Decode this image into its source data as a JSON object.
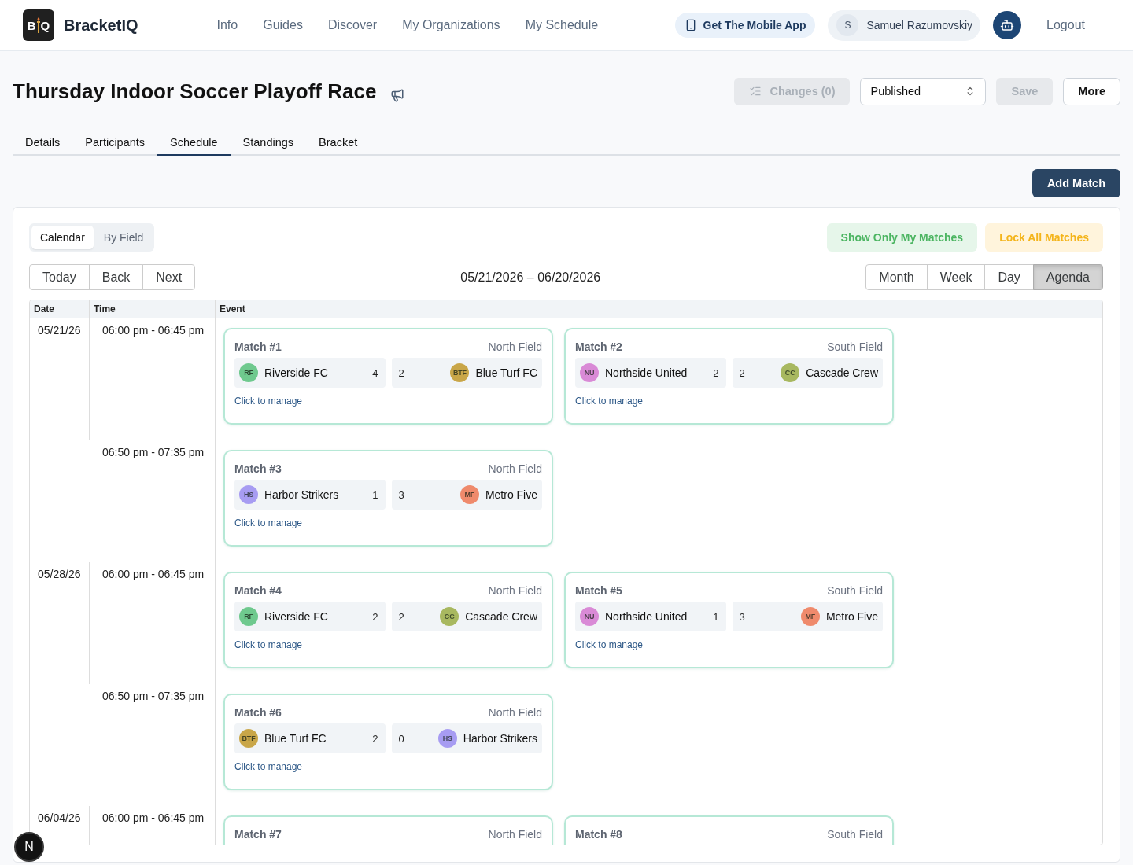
{
  "header": {
    "logo": {
      "letters": [
        "B",
        "Q"
      ]
    },
    "brand": "BracketIQ",
    "nav": [
      "Info",
      "Guides",
      "Discover",
      "My Organizations",
      "My Schedule"
    ],
    "mobile_app": "Get The Mobile App",
    "user": {
      "initial": "S",
      "name": "Samuel Razumovskiy"
    },
    "logout": "Logout"
  },
  "page": {
    "title": "Thursday Indoor Soccer Playoff Race",
    "changes": {
      "label": "Changes (0)",
      "disabled": true
    },
    "status": "Published",
    "save": {
      "label": "Save",
      "disabled": true
    },
    "more": "More"
  },
  "tabs": [
    {
      "label": "Details",
      "selected": false
    },
    {
      "label": "Participants",
      "selected": false
    },
    {
      "label": "Schedule",
      "selected": true
    },
    {
      "label": "Standings",
      "selected": false
    },
    {
      "label": "Bracket",
      "selected": false
    }
  ],
  "add_match": "Add Match",
  "schedule": {
    "view_switch": [
      {
        "label": "Calendar",
        "selected": true
      },
      {
        "label": "By Field",
        "selected": false
      }
    ],
    "show_only_mine": "Show Only My Matches",
    "lock_all": "Lock All Matches",
    "nav_buttons": [
      "Today",
      "Back",
      "Next"
    ],
    "range": "05/21/2026 – 06/20/2026",
    "views": [
      {
        "label": "Month",
        "selected": false
      },
      {
        "label": "Week",
        "selected": false
      },
      {
        "label": "Day",
        "selected": false
      },
      {
        "label": "Agenda",
        "selected": true
      }
    ],
    "agenda": {
      "columns": [
        "Date",
        "Time",
        "Event"
      ],
      "days": [
        {
          "date": "05/21/26",
          "slots": [
            {
              "time": "06:00 pm - 06:45 pm",
              "matches": [
                {
                  "title": "Match #1",
                  "field": "North Field",
                  "home": {
                    "initials": "RF",
                    "name": "Riverside FC",
                    "score": "4",
                    "color": "#6fc98e"
                  },
                  "away": {
                    "initials": "BTF",
                    "name": "Blue Turf FC",
                    "score": "2",
                    "color": "#c9a648"
                  },
                  "action": "Click to manage"
                },
                {
                  "title": "Match #2",
                  "field": "South Field",
                  "home": {
                    "initials": "NU",
                    "name": "Northside United",
                    "score": "2",
                    "color": "#d98ad6"
                  },
                  "away": {
                    "initials": "CC",
                    "name": "Cascade Crew",
                    "score": "2",
                    "color": "#a8b860"
                  },
                  "action": "Click to manage"
                }
              ]
            },
            {
              "time": "06:50 pm - 07:35 pm",
              "matches": [
                {
                  "title": "Match #3",
                  "field": "North Field",
                  "home": {
                    "initials": "HS",
                    "name": "Harbor Strikers",
                    "score": "1",
                    "color": "#a79cf2"
                  },
                  "away": {
                    "initials": "MF",
                    "name": "Metro Five",
                    "score": "3",
                    "color": "#ef8a6c"
                  },
                  "action": "Click to manage"
                }
              ]
            }
          ]
        },
        {
          "date": "05/28/26",
          "slots": [
            {
              "time": "06:00 pm - 06:45 pm",
              "matches": [
                {
                  "title": "Match #4",
                  "field": "North Field",
                  "home": {
                    "initials": "RF",
                    "name": "Riverside FC",
                    "score": "2",
                    "color": "#6fc98e"
                  },
                  "away": {
                    "initials": "CC",
                    "name": "Cascade Crew",
                    "score": "2",
                    "color": "#a8b860"
                  },
                  "action": "Click to manage"
                },
                {
                  "title": "Match #5",
                  "field": "South Field",
                  "home": {
                    "initials": "NU",
                    "name": "Northside United",
                    "score": "1",
                    "color": "#d98ad6"
                  },
                  "away": {
                    "initials": "MF",
                    "name": "Metro Five",
                    "score": "3",
                    "color": "#ef8a6c"
                  },
                  "action": "Click to manage"
                }
              ]
            },
            {
              "time": "06:50 pm - 07:35 pm",
              "matches": [
                {
                  "title": "Match #6",
                  "field": "North Field",
                  "home": {
                    "initials": "BTF",
                    "name": "Blue Turf FC",
                    "score": "2",
                    "color": "#c9a648"
                  },
                  "away": {
                    "initials": "HS",
                    "name": "Harbor Strikers",
                    "score": "0",
                    "color": "#a79cf2"
                  },
                  "action": "Click to manage"
                }
              ]
            }
          ]
        },
        {
          "date": "06/04/26",
          "slots": [
            {
              "time": "06:00 pm - 06:45 pm",
              "matches": [
                {
                  "title": "Match #7",
                  "field": "North Field"
                },
                {
                  "title": "Match #8",
                  "field": "South Field"
                }
              ]
            }
          ]
        }
      ]
    }
  },
  "dev_badge": "N"
}
